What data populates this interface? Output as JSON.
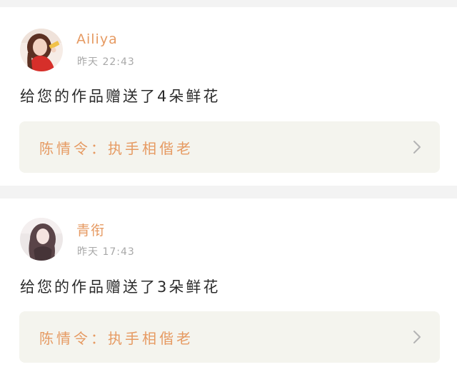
{
  "feed": {
    "items": [
      {
        "username": "Ailiya",
        "timestamp": "昨天 22:43",
        "message": "给您的作品赠送了4朵鲜花",
        "work_title": "陈情令：执手相偕老",
        "avatar_icon": "avatar-girl-red-outfit"
      },
      {
        "username": "青衔",
        "timestamp": "昨天 17:43",
        "message": "给您的作品赠送了3朵鲜花",
        "work_title": "陈情令：执手相偕老",
        "avatar_icon": "avatar-girl-long-hair"
      }
    ]
  },
  "colors": {
    "accent": "#e69a62",
    "card_background": "#ffffff",
    "page_background": "#f3f3f3",
    "link_background": "#f4f4ee",
    "timestamp": "#a8a8a8",
    "text": "#2b2b2b"
  }
}
